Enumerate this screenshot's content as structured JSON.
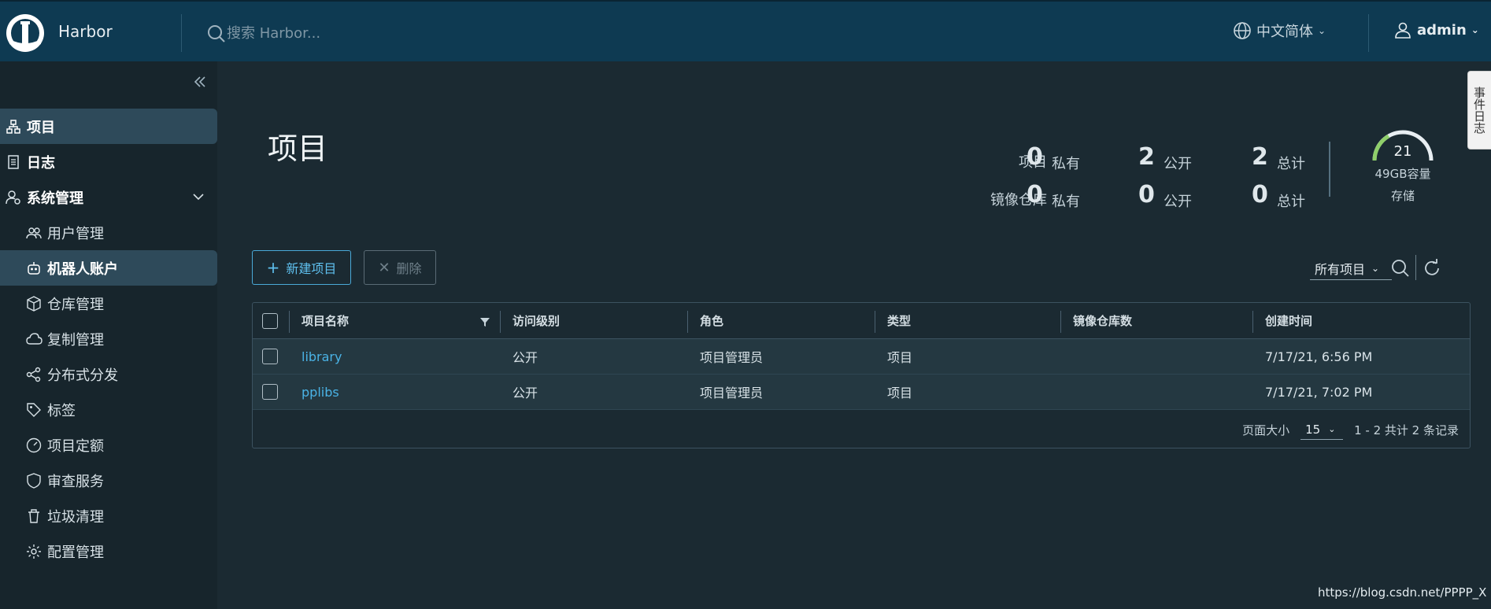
{
  "header": {
    "brand": "Harbor",
    "search_placeholder": "搜索 Harbor...",
    "language": "中文简体",
    "user": "admin"
  },
  "sidebar": {
    "items": [
      {
        "label": "项目",
        "icon": "project-icon"
      },
      {
        "label": "日志",
        "icon": "log-icon"
      },
      {
        "label": "系统管理",
        "icon": "admin-icon"
      },
      {
        "label": "用户管理",
        "icon": "users-icon"
      },
      {
        "label": "机器人账户",
        "icon": "robot-icon"
      },
      {
        "label": "仓库管理",
        "icon": "box-icon"
      },
      {
        "label": "复制管理",
        "icon": "cloud-icon"
      },
      {
        "label": "分布式分发",
        "icon": "share-icon"
      },
      {
        "label": "标签",
        "icon": "tag-icon"
      },
      {
        "label": "项目定额",
        "icon": "quota-icon"
      },
      {
        "label": "审查服务",
        "icon": "shield-icon"
      },
      {
        "label": "垃圾清理",
        "icon": "trash-icon"
      },
      {
        "label": "配置管理",
        "icon": "gear-icon"
      }
    ]
  },
  "page": {
    "title": "项目",
    "stats": {
      "projects_label": "项目",
      "repos_label": "镜像仓库",
      "private_label": "私有",
      "public_label": "公开",
      "total_label": "总计",
      "projects": {
        "private": "0",
        "public": "2",
        "total": "2"
      },
      "repos": {
        "private": "0",
        "public": "0",
        "total": "0"
      }
    },
    "storage": {
      "value": "21",
      "capacity": "49GB容量",
      "label": "存储"
    }
  },
  "toolbar": {
    "new_project": "新建项目",
    "delete": "删除",
    "filter": "所有项目"
  },
  "table": {
    "headers": [
      "项目名称",
      "访问级别",
      "角色",
      "类型",
      "镜像仓库数",
      "创建时间"
    ],
    "rows": [
      {
        "name": "library",
        "access": "公开",
        "role": "项目管理员",
        "type": "项目",
        "repos": "",
        "created": "7/17/21, 6:56 PM"
      },
      {
        "name": "pplibs",
        "access": "公开",
        "role": "项目管理员",
        "type": "项目",
        "repos": "",
        "created": "7/17/21, 7:02 PM"
      }
    ],
    "footer": {
      "page_size_label": "页面大小",
      "page_size": "15",
      "summary": "1 - 2 共计 2 条记录"
    }
  },
  "side_tab": "事件日志",
  "watermark": "https://blog.csdn.net/PPPP_X",
  "colors": {
    "topbar": "#0e3a52",
    "sidebar": "#17252c",
    "main": "#1b2a32",
    "accent": "#4ab3e6"
  }
}
